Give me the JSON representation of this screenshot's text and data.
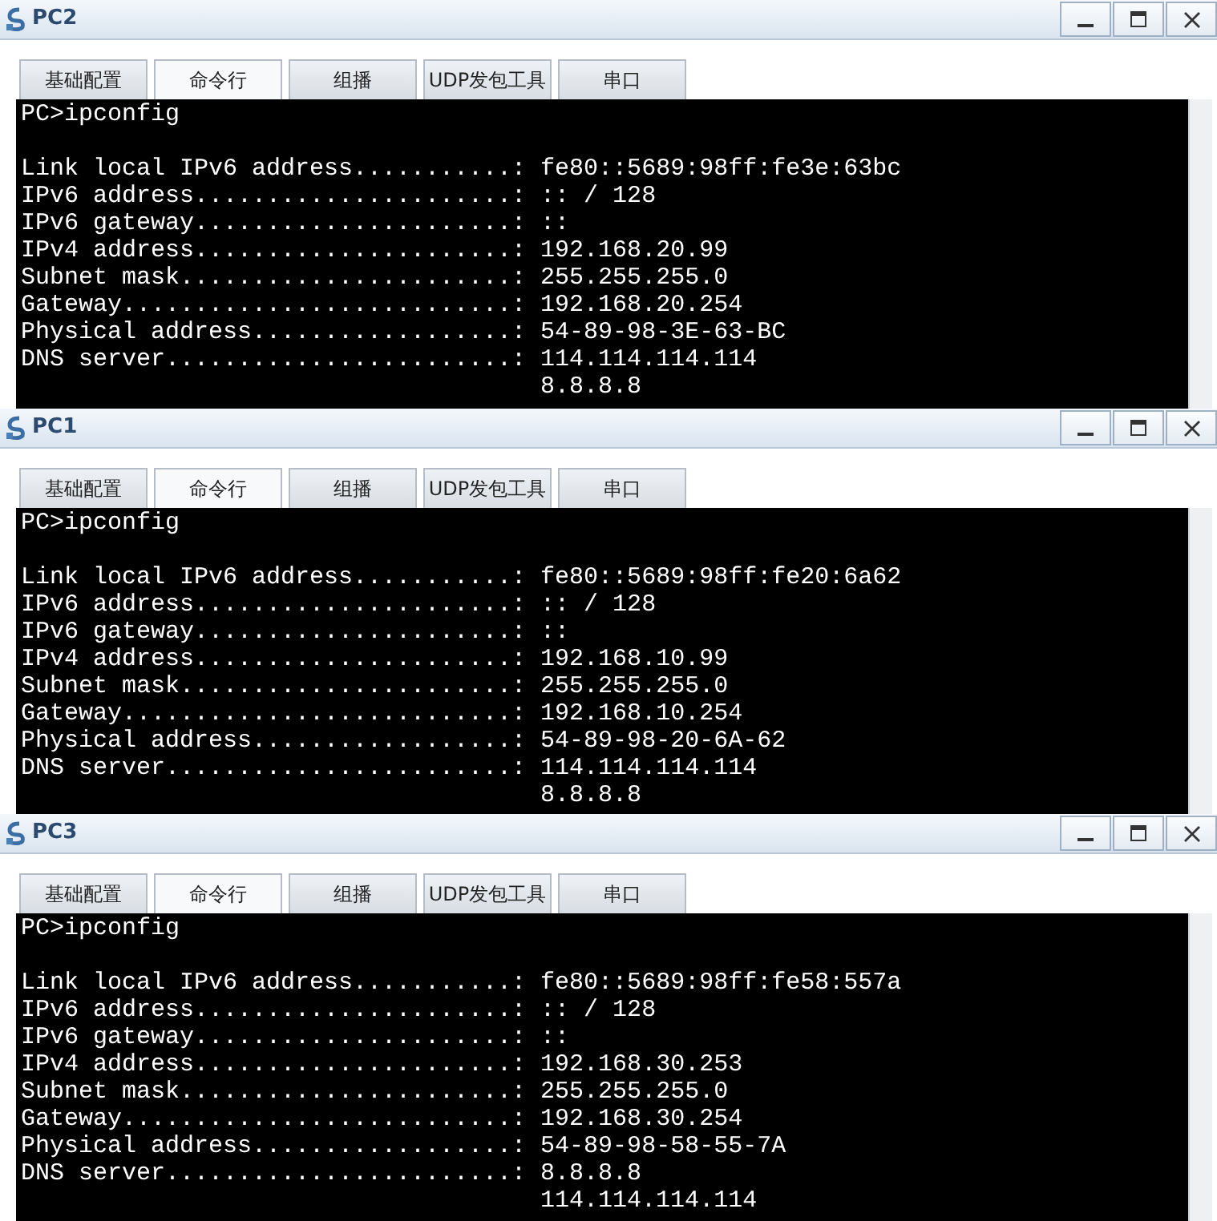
{
  "windows": [
    {
      "title": "PC2",
      "tabs": [
        {
          "label": "基础配置",
          "selected": false
        },
        {
          "label": "命令行",
          "selected": true
        },
        {
          "label": "组播",
          "selected": false
        },
        {
          "label": "UDP发包工具",
          "selected": false
        },
        {
          "label": "串口",
          "selected": false
        }
      ],
      "command": "PC>ipconfig",
      "lines": [
        {
          "kind": "line",
          "text": "Link local IPv6 address...........: fe80::5689:98ff:fe3e:63bc"
        },
        {
          "kind": "line",
          "text": "IPv6 address......................: :: / 128"
        },
        {
          "kind": "line",
          "text": "IPv6 gateway......................: ::"
        },
        {
          "kind": "line",
          "text": "IPv4 address......................: 192.168.20.99"
        },
        {
          "kind": "line",
          "text": "Subnet mask.......................: 255.255.255.0"
        },
        {
          "kind": "line",
          "text": "Gateway...........................: 192.168.20.254"
        },
        {
          "kind": "line",
          "text": "Physical address..................: 54-89-98-3E-63-BC"
        },
        {
          "kind": "line",
          "text": "DNS server........................: 114.114.114.114"
        },
        {
          "kind": "continuation",
          "text": "8.8.8.8"
        }
      ]
    },
    {
      "title": "PC1",
      "tabs": [
        {
          "label": "基础配置",
          "selected": false
        },
        {
          "label": "命令行",
          "selected": true
        },
        {
          "label": "组播",
          "selected": false
        },
        {
          "label": "UDP发包工具",
          "selected": false
        },
        {
          "label": "串口",
          "selected": false
        }
      ],
      "command": "PC>ipconfig",
      "lines": [
        {
          "kind": "line",
          "text": "Link local IPv6 address...........: fe80::5689:98ff:fe20:6a62"
        },
        {
          "kind": "line",
          "text": "IPv6 address......................: :: / 128"
        },
        {
          "kind": "line",
          "text": "IPv6 gateway......................: ::"
        },
        {
          "kind": "line",
          "text": "IPv4 address......................: 192.168.10.99"
        },
        {
          "kind": "line",
          "text": "Subnet mask.......................: 255.255.255.0"
        },
        {
          "kind": "line",
          "text": "Gateway...........................: 192.168.10.254"
        },
        {
          "kind": "line",
          "text": "Physical address..................: 54-89-98-20-6A-62"
        },
        {
          "kind": "line",
          "text": "DNS server........................: 114.114.114.114"
        },
        {
          "kind": "continuation",
          "text": "8.8.8.8"
        }
      ]
    },
    {
      "title": "PC3",
      "tabs": [
        {
          "label": "基础配置",
          "selected": false
        },
        {
          "label": "命令行",
          "selected": true
        },
        {
          "label": "组播",
          "selected": false
        },
        {
          "label": "UDP发包工具",
          "selected": false
        },
        {
          "label": "串口",
          "selected": false
        }
      ],
      "command": "PC>ipconfig",
      "lines": [
        {
          "kind": "line",
          "text": "Link local IPv6 address...........: fe80::5689:98ff:fe58:557a"
        },
        {
          "kind": "line",
          "text": "IPv6 address......................: :: / 128"
        },
        {
          "kind": "line",
          "text": "IPv6 gateway......................: ::"
        },
        {
          "kind": "line",
          "text": "IPv4 address......................: 192.168.30.253"
        },
        {
          "kind": "line",
          "text": "Subnet mask.......................: 255.255.255.0"
        },
        {
          "kind": "line",
          "text": "Gateway...........................: 192.168.30.254"
        },
        {
          "kind": "line",
          "text": "Physical address..................: 54-89-98-58-55-7A"
        },
        {
          "kind": "line",
          "text": "DNS server........................: 8.8.8.8"
        },
        {
          "kind": "continuation",
          "text": "114.114.114.114"
        }
      ]
    }
  ]
}
